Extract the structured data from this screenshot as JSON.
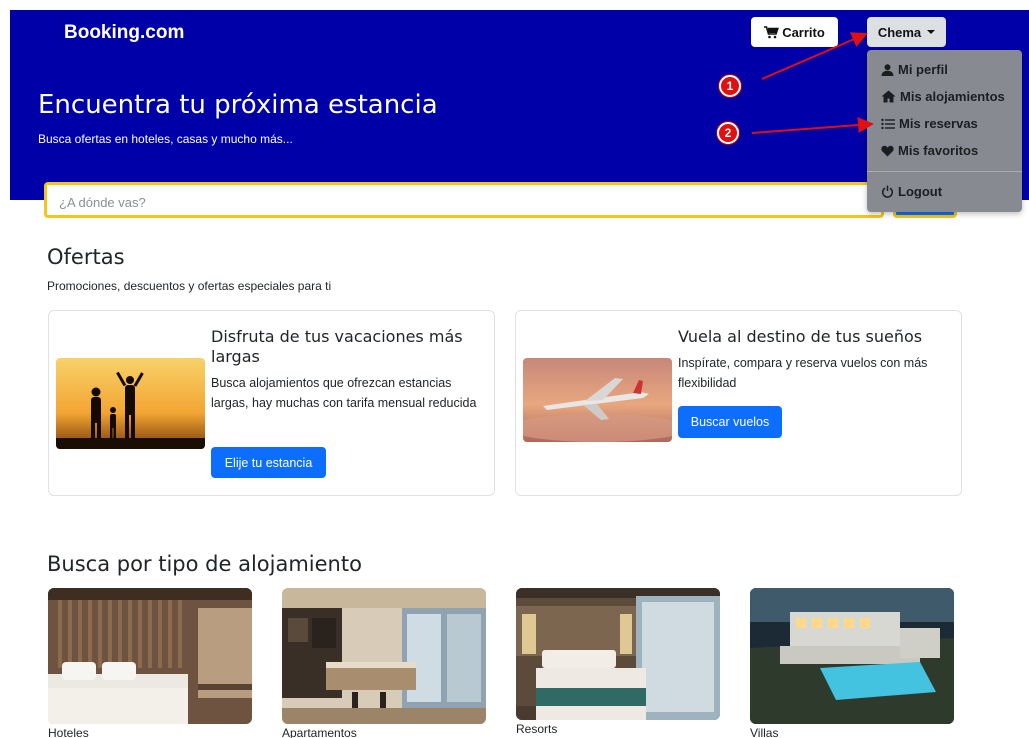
{
  "header": {
    "brand": "Booking.com",
    "cart_label": "Carrito",
    "user_label": "Chema",
    "title": "Encuentra tu próxima estancia",
    "subtitle": "Busca ofertas en hoteles, casas y mucho más..."
  },
  "search": {
    "placeholder": "¿A dónde vas?"
  },
  "user_menu": {
    "items": [
      {
        "label": "Mi perfil",
        "icon": "user-icon"
      },
      {
        "label": "Mis alojamientos",
        "icon": "home-icon"
      },
      {
        "label": "Mis reservas",
        "icon": "list-icon"
      },
      {
        "label": "Mis favoritos",
        "icon": "heart-icon"
      }
    ],
    "logout_label": "Logout"
  },
  "annotations": {
    "marker_1": "1",
    "marker_2": "2"
  },
  "offers": {
    "title": "Ofertas",
    "subtitle": "Promociones, descuentos y ofertas especiales para ti",
    "cards": [
      {
        "title": "Disfruta de tus vacaciones más largas",
        "text": "Busca alojamientos que ofrezcan estancias largas, hay muchas con tarifa mensual reducida",
        "button": "Elije tu estancia"
      },
      {
        "title": "Vuela al destino de tus sueños",
        "text": "Inspírate, compara y reserva vuelos con más flexibilidad",
        "button": "Buscar vuelos"
      }
    ]
  },
  "types": {
    "title": "Busca por tipo de alojamiento",
    "items": [
      {
        "label": "Hoteles"
      },
      {
        "label": "Apartamentos"
      },
      {
        "label": "Resorts"
      },
      {
        "label": "Villas"
      }
    ]
  },
  "colors": {
    "hero": "#0000a8",
    "primary": "#0d6efd",
    "search_border": "#f5c518",
    "marker": "#e01010"
  }
}
